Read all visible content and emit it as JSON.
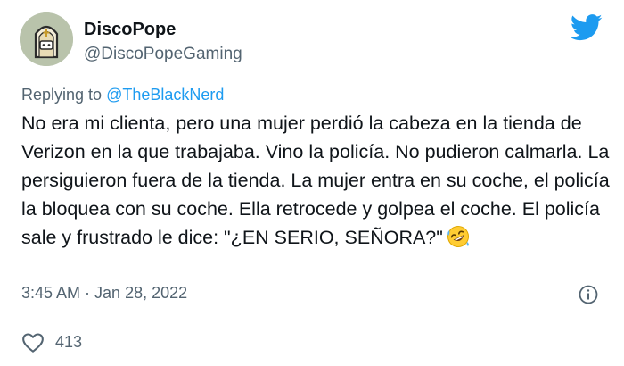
{
  "tweet": {
    "author": {
      "name": "DiscoPope",
      "handle": "@DiscoPopeGaming",
      "avatar_icon": "pope-mitre-avatar"
    },
    "reply": {
      "prefix": "Replying to ",
      "mention": "@TheBlackNerd"
    },
    "text": "No era mi clienta, pero una mujer perdió la cabeza en la tienda de Verizon en la que trabajaba. Vino la policía. No pudieron calmarla. La persiguieron fuera de la tienda. La mujer entra en su coche, el policía la bloquea con su coche. Ella retrocede y golpea el coche. El policía sale y frustrado le dice: \"¿EN SERIO, SEÑORA?\"",
    "emoji": "rolling-on-floor-laughing-emoji",
    "time": "3:45 AM",
    "separator": " · ",
    "date": "Jan 28, 2022",
    "likes": "413",
    "brand_icon": "twitter-bird-icon",
    "colors": {
      "accent": "#1d9bf0",
      "muted": "#536471",
      "text": "#0f1419",
      "divider": "#cfd9de"
    }
  }
}
